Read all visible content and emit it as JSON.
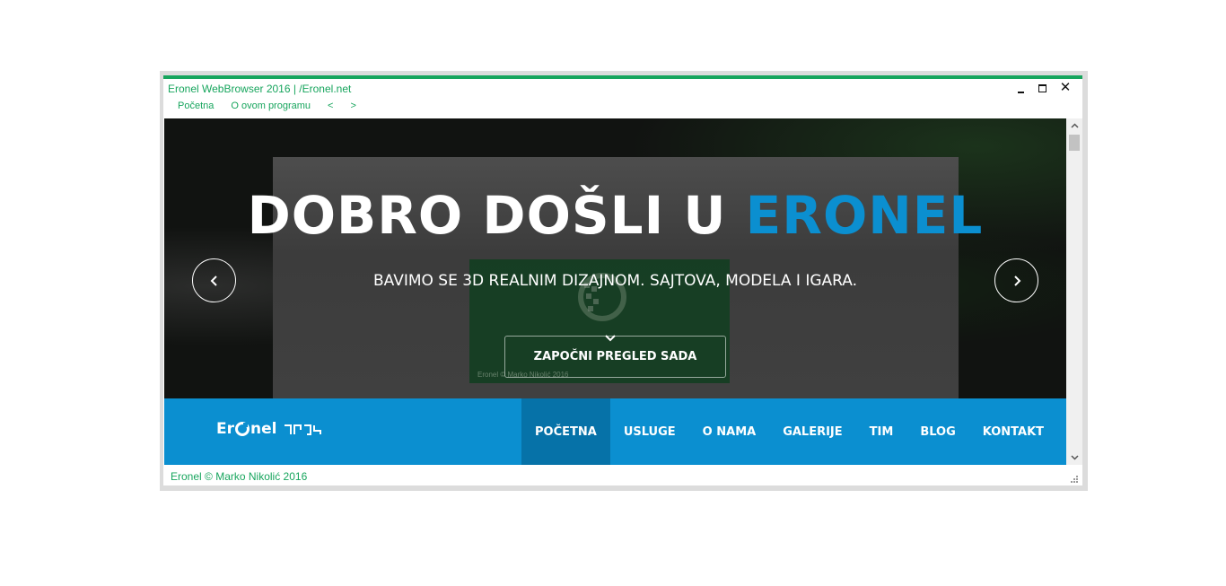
{
  "window": {
    "title": "Eronel WebBrowser 2016 | /Eronel.net",
    "accent_color": "#17a55d",
    "controls": {
      "minimize": "minimize-icon",
      "maximize": "maximize-icon",
      "close": "✕"
    }
  },
  "menu": {
    "items": [
      {
        "label": "Početna"
      },
      {
        "label": "O ovom programu"
      },
      {
        "label": "<"
      },
      {
        "label": ">"
      }
    ]
  },
  "hero": {
    "title_main": "DOBRO DOŠLI U ",
    "title_accent": "ERONEL",
    "subtitle": "BAVIMO SE 3D REALNIM DIZAJNOM. SAJTOVA, MODELA I IGARA.",
    "cta_label": "ZAPOČNI PREGLED SADA",
    "watermark_caption": "Eronel © Marko Nikolić 2016",
    "accent_color": "#0b8fd0",
    "prev_icon": "chevron-left-icon",
    "next_icon": "chevron-right-icon"
  },
  "navbar": {
    "brand_text": "Er",
    "brand_text_tail": "nel",
    "background": "#0b8fd0",
    "items": [
      {
        "label": "POČETNA",
        "active": true
      },
      {
        "label": "USLUGE",
        "active": false
      },
      {
        "label": "O NAMA",
        "active": false
      },
      {
        "label": "GALERIJE",
        "active": false
      },
      {
        "label": "TIM",
        "active": false
      },
      {
        "label": "BLOG",
        "active": false
      },
      {
        "label": "KONTAKT",
        "active": false
      }
    ]
  },
  "status": {
    "text": "Eronel © Marko Nikolić 2016"
  }
}
